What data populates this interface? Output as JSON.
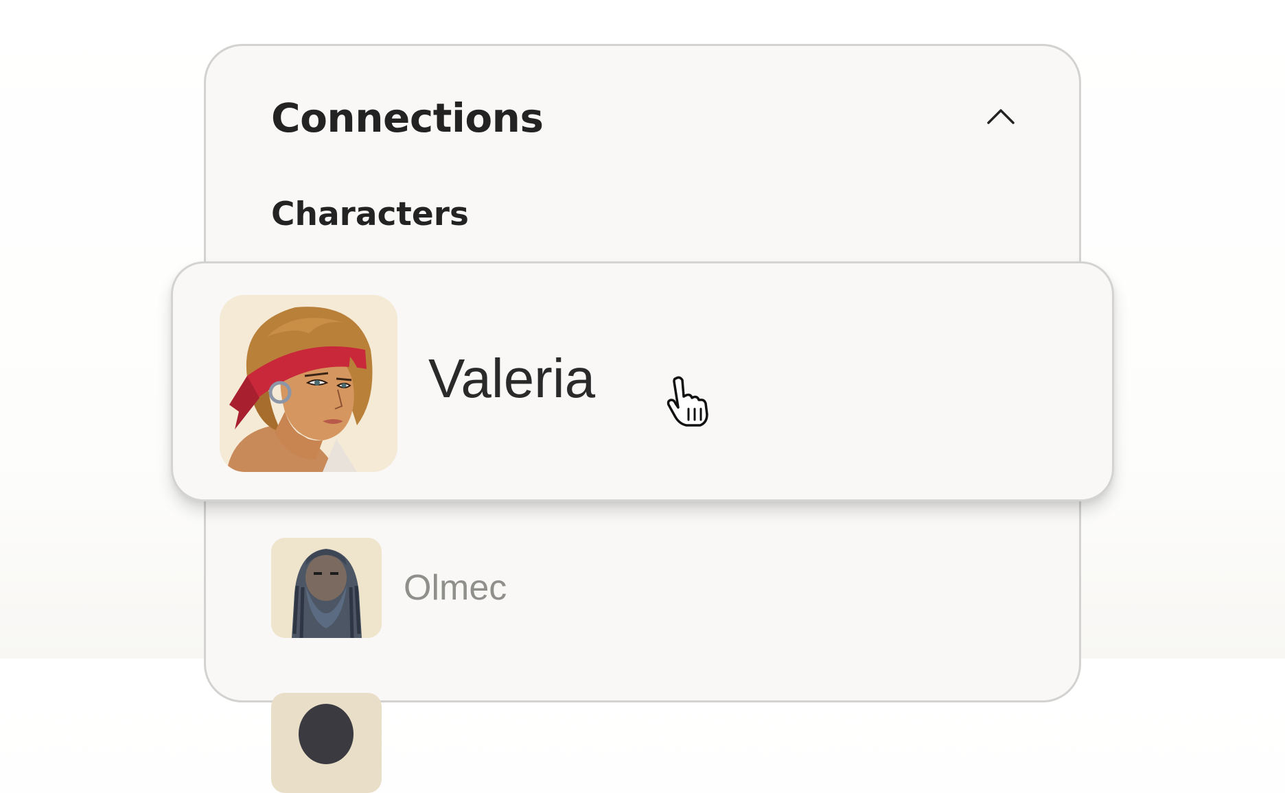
{
  "panel": {
    "title": "Connections",
    "collapse_icon": "chevron-up-icon",
    "section_label": "Characters"
  },
  "highlighted_character": {
    "name": "Valeria",
    "avatar_icon": "character-portrait-icon"
  },
  "characters": [
    {
      "name": "Olmec",
      "avatar_icon": "character-portrait-icon"
    }
  ],
  "colors": {
    "background": "#ffffff",
    "panel_background": "#f9f8f6",
    "border": "#d2d2d0",
    "text_primary": "#232323",
    "text_muted": "#8f8f8c",
    "bandana_red": "#c8283a"
  },
  "cursor": {
    "type": "hand-pointer-icon"
  }
}
